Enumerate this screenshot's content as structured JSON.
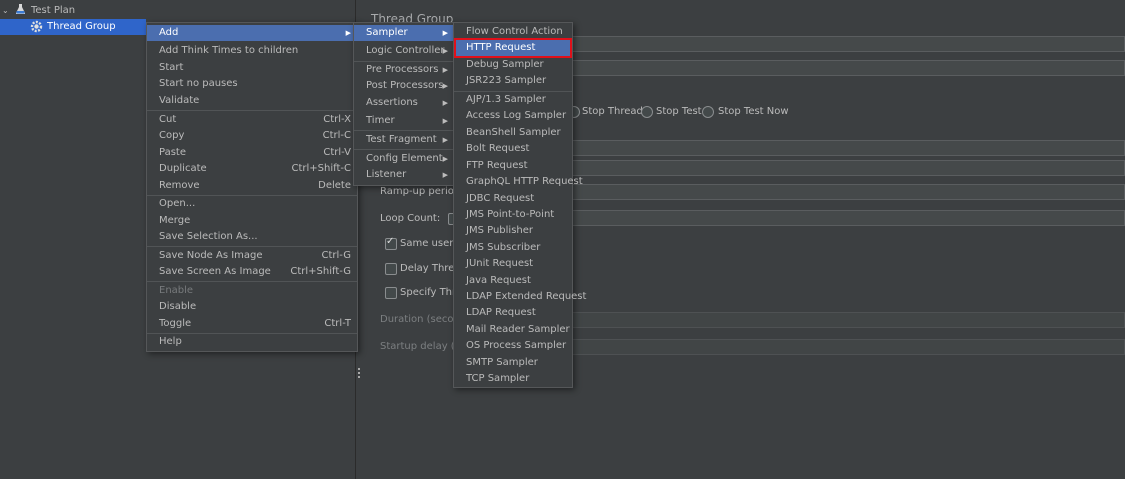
{
  "tree": {
    "items": [
      {
        "label": "Test Plan",
        "icon": "flask-icon"
      },
      {
        "label": "Thread Group",
        "icon": "gear-icon"
      }
    ]
  },
  "panel": {
    "title": "Thread Group",
    "radios": [
      "Stop Thread",
      "Stop Test",
      "Stop Test Now"
    ],
    "rampup_label": "Ramp-up period (",
    "loop_label": "Loop Count:",
    "same_user_label": "Same user or",
    "delay_label": "Delay Thread",
    "specify_label": "Specify Threa",
    "duration_label": "Duration (second",
    "startup_label": "Startup delay (sec"
  },
  "context_menu": {
    "items": [
      {
        "label": "Add",
        "arrow": "▶"
      },
      {
        "label": "Add Think Times to children"
      },
      {
        "label": "Start"
      },
      {
        "label": "Start no pauses"
      },
      {
        "label": "Validate"
      },
      {
        "label": "Cut",
        "shortcut": "Ctrl-X"
      },
      {
        "label": "Copy",
        "shortcut": "Ctrl-C"
      },
      {
        "label": "Paste",
        "shortcut": "Ctrl-V"
      },
      {
        "label": "Duplicate",
        "shortcut": "Ctrl+Shift-C"
      },
      {
        "label": "Remove",
        "shortcut": "Delete"
      },
      {
        "label": "Open..."
      },
      {
        "label": "Merge"
      },
      {
        "label": "Save Selection As..."
      },
      {
        "label": "Save Node As Image",
        "shortcut": "Ctrl-G"
      },
      {
        "label": "Save Screen As Image",
        "shortcut": "Ctrl+Shift-G"
      },
      {
        "label": "Enable"
      },
      {
        "label": "Disable"
      },
      {
        "label": "Toggle",
        "shortcut": "Ctrl-T"
      },
      {
        "label": "Help"
      }
    ]
  },
  "add_submenu": {
    "items": [
      {
        "label": "Sampler",
        "arrow": "▶"
      },
      {
        "label": "Logic Controller",
        "arrow": "▶"
      },
      {
        "label": "Pre Processors",
        "arrow": "▶"
      },
      {
        "label": "Post Processors",
        "arrow": "▶"
      },
      {
        "label": "Assertions",
        "arrow": "▶"
      },
      {
        "label": "Timer",
        "arrow": "▶"
      },
      {
        "label": "Test Fragment",
        "arrow": "▶"
      },
      {
        "label": "Config Element",
        "arrow": "▶"
      },
      {
        "label": "Listener",
        "arrow": "▶"
      }
    ]
  },
  "sampler_submenu": {
    "items": [
      {
        "label": "Flow Control Action"
      },
      {
        "label": "HTTP Request"
      },
      {
        "label": "Debug Sampler"
      },
      {
        "label": "JSR223 Sampler"
      },
      {
        "label": "AJP/1.3 Sampler"
      },
      {
        "label": "Access Log Sampler"
      },
      {
        "label": "BeanShell Sampler"
      },
      {
        "label": "Bolt Request"
      },
      {
        "label": "FTP Request"
      },
      {
        "label": "GraphQL HTTP Request"
      },
      {
        "label": "JDBC Request"
      },
      {
        "label": "JMS Point-to-Point"
      },
      {
        "label": "JMS Publisher"
      },
      {
        "label": "JMS Subscriber"
      },
      {
        "label": "JUnit Request"
      },
      {
        "label": "Java Request"
      },
      {
        "label": "LDAP Extended Request"
      },
      {
        "label": "LDAP Request"
      },
      {
        "label": "Mail Reader Sampler"
      },
      {
        "label": "OS Process Sampler"
      },
      {
        "label": "SMTP Sampler"
      },
      {
        "label": "TCP Sampler"
      }
    ]
  },
  "colors": {
    "background": "#3c3f41",
    "selection": "#2f65ca",
    "menu_highlight": "#4b6eaf",
    "annotation_red": "#e0101a"
  }
}
